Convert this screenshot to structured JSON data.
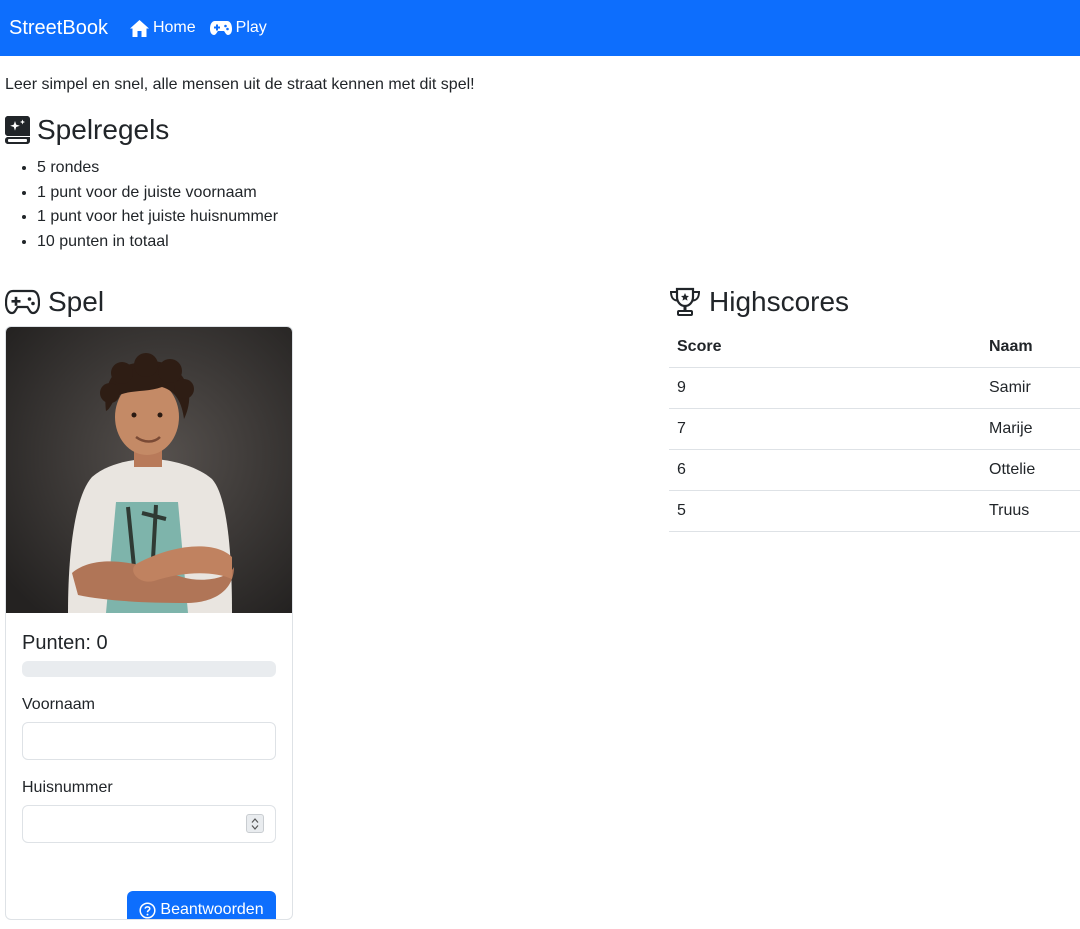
{
  "navbar": {
    "brand": "StreetBook",
    "links": [
      {
        "label": "Home",
        "icon": "home-icon"
      },
      {
        "label": "Play",
        "icon": "gamepad-icon"
      }
    ],
    "color": "#0d6efd"
  },
  "intro": "Leer simpel en snel, alle mensen uit de straat kennen met dit spel!",
  "rules": {
    "title": "Spelregels",
    "icon": "rulebook-icon",
    "items": [
      "5 rondes",
      "1 punt voor de juiste voornaam",
      "1 punt voor het juiste huisnummer",
      "10 punten in totaal"
    ]
  },
  "game": {
    "title": "Spel",
    "icon": "gamepad-icon",
    "score_label": "Punten: 0",
    "progress_fraction": 0,
    "firstname_label": "Voornaam",
    "firstname_value": "",
    "housenumber_label": "Huisnummer",
    "housenumber_value": "",
    "submit_label": "Beantwoorden",
    "submit_icon": "question-circle-icon"
  },
  "highscores": {
    "title": "Highscores",
    "icon": "trophy-icon",
    "columns": [
      "Score",
      "Naam"
    ],
    "rows": [
      {
        "score": "9",
        "name": "Samir"
      },
      {
        "score": "7",
        "name": "Marije"
      },
      {
        "score": "6",
        "name": "Ottelie"
      },
      {
        "score": "5",
        "name": "Truus"
      }
    ]
  }
}
